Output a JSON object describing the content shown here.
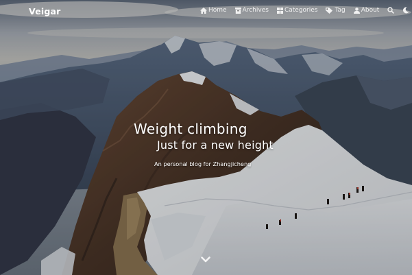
{
  "brand": {
    "title": "Veigar"
  },
  "nav": {
    "items": [
      {
        "label": "Home",
        "icon": "home-icon"
      },
      {
        "label": "Archives",
        "icon": "archive-icon"
      },
      {
        "label": "Categories",
        "icon": "categories-icon"
      },
      {
        "label": "Tag",
        "icon": "tag-icon"
      },
      {
        "label": "About",
        "icon": "user-icon"
      }
    ],
    "search_icon": "search-icon",
    "theme_icon": "moon-icon"
  },
  "hero": {
    "title_line_1": "Weight climbing",
    "title_line_2": "Just for a new height",
    "subtitle": "An personal blog for Zhangjicheng",
    "scroll_icon": "chevron-down-icon"
  },
  "colors": {
    "text": "#ffffff",
    "snow": "#eef1f4",
    "sky": "#8c97a6",
    "rock": "#5a4234"
  }
}
